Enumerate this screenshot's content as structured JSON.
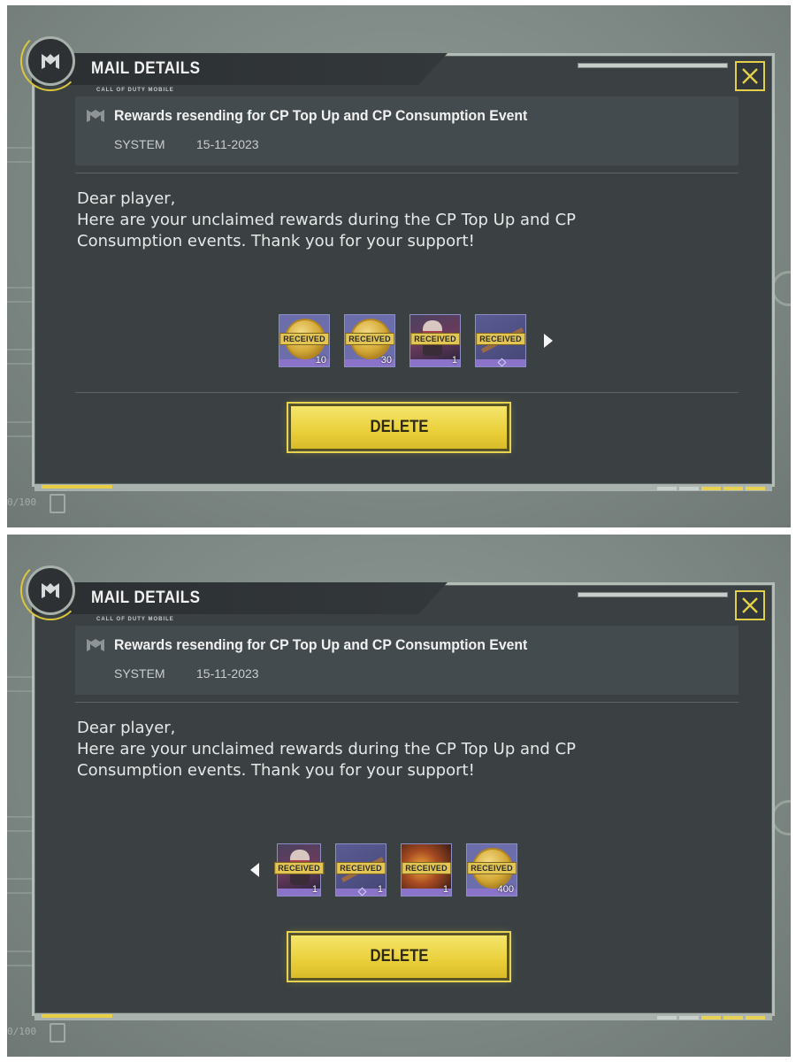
{
  "screenshots": [
    {
      "panel_title": "MAIL DETAILS",
      "brand_subtitle": "CALL OF DUTY MOBILE",
      "mail": {
        "subject": "Rewards resending for CP Top Up and CP Consumption Event",
        "sender": "SYSTEM",
        "date": "15-11-2023"
      },
      "body_lines": [
        "Dear player,",
        "Here are your unclaimed rewards during the CP Top Up and CP",
        "Consumption events. Thank you for your support!"
      ],
      "rewards": [
        {
          "type": "coin",
          "status": "RECEIVED",
          "qty": "10"
        },
        {
          "type": "coin",
          "status": "RECEIVED",
          "qty": "30"
        },
        {
          "type": "character",
          "status": "RECEIVED",
          "qty": "1"
        },
        {
          "type": "weapon",
          "status": "RECEIVED",
          "qty": ""
        }
      ],
      "carousel_arrow": "right",
      "delete_label": "DELETE",
      "background_counter": "0/100",
      "accent_color": "#e8d44c"
    },
    {
      "panel_title": "MAIL DETAILS",
      "brand_subtitle": "CALL OF DUTY MOBILE",
      "mail": {
        "subject": "Rewards resending for CP Top Up and CP Consumption Event",
        "sender": "SYSTEM",
        "date": "15-11-2023"
      },
      "body_lines": [
        "Dear player,",
        "Here are your unclaimed rewards during the CP Top Up and CP",
        "Consumption events. Thank you for your support!"
      ],
      "rewards": [
        {
          "type": "character",
          "status": "RECEIVED",
          "qty": "1"
        },
        {
          "type": "weapon",
          "status": "RECEIVED",
          "qty": "1"
        },
        {
          "type": "fire",
          "status": "RECEIVED",
          "qty": "1"
        },
        {
          "type": "coin",
          "status": "RECEIVED",
          "qty": "400"
        }
      ],
      "carousel_arrow": "left",
      "delete_label": "DELETE",
      "background_counter": "0/100",
      "accent_color": "#e8d44c"
    }
  ]
}
